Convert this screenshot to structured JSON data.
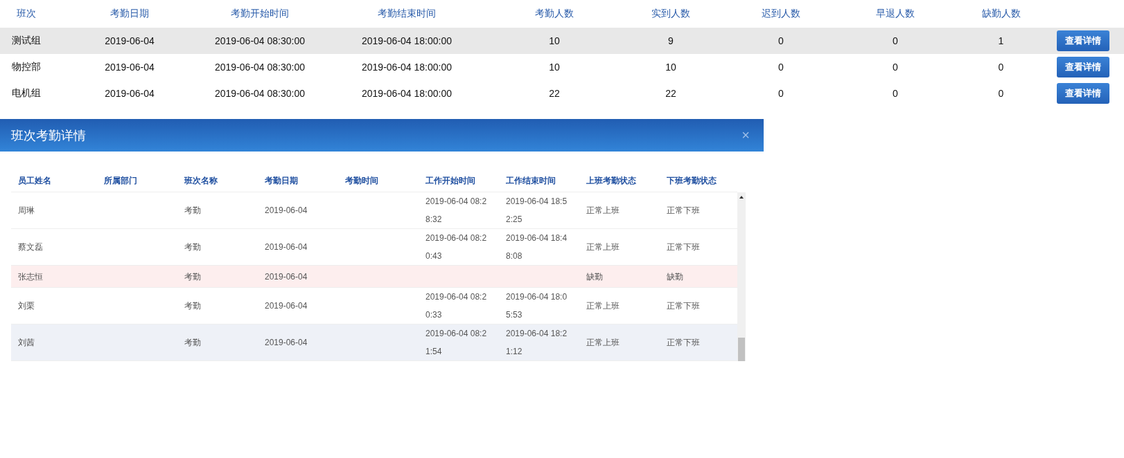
{
  "summary_table": {
    "columns": [
      "班次",
      "考勤日期",
      "考勤开始时间",
      "考勤结束时间",
      "考勤人数",
      "实到人数",
      "迟到人数",
      "早退人数",
      "缺勤人数"
    ],
    "rows": [
      {
        "selected": true,
        "cells": [
          "测试组",
          "2019-06-04",
          "2019-06-04 08:30:00",
          "2019-06-04 18:00:00",
          "10",
          "9",
          "0",
          "0",
          "1"
        ],
        "button": "查看详情"
      },
      {
        "selected": false,
        "cells": [
          "物控部",
          "2019-06-04",
          "2019-06-04 08:30:00",
          "2019-06-04 18:00:00",
          "10",
          "10",
          "0",
          "0",
          "0"
        ],
        "button": "查看详情"
      },
      {
        "selected": false,
        "cells": [
          "电机组",
          "2019-06-04",
          "2019-06-04 08:30:00",
          "2019-06-04 18:00:00",
          "22",
          "22",
          "0",
          "0",
          "0"
        ],
        "button": "查看详情"
      }
    ]
  },
  "dialog": {
    "title": "班次考勤详情",
    "close": "×",
    "columns": [
      "员工姓名",
      "所属部门",
      "班次名称",
      "考勤日期",
      "考勤时间",
      "工作开始时间",
      "工作结束时间",
      "上班考勤状态",
      "下班考勤状态"
    ],
    "rows": [
      {
        "absent": false,
        "highlighted": false,
        "cells": [
          "周琳",
          "",
          "考勤",
          "2019-06-04",
          "",
          "2019-06-04 08:28:32",
          "2019-06-04 18:52:25",
          "正常上班",
          "正常下班"
        ]
      },
      {
        "absent": false,
        "highlighted": false,
        "cells": [
          "蔡文磊",
          "",
          "考勤",
          "2019-06-04",
          "",
          "2019-06-04 08:20:43",
          "2019-06-04 18:48:08",
          "正常上班",
          "正常下班"
        ]
      },
      {
        "absent": true,
        "highlighted": false,
        "cells": [
          "张志恒",
          "",
          "考勤",
          "2019-06-04",
          "",
          "",
          "",
          "缺勤",
          "缺勤"
        ]
      },
      {
        "absent": false,
        "highlighted": false,
        "cells": [
          "刘栗",
          "",
          "考勤",
          "2019-06-04",
          "",
          "2019-06-04 08:20:33",
          "2019-06-04 18:05:53",
          "正常上班",
          "正常下班"
        ]
      },
      {
        "absent": false,
        "highlighted": true,
        "cells": [
          "刘茜",
          "",
          "考勤",
          "2019-06-04",
          "",
          "2019-06-04 08:21:54",
          "2019-06-04 18:21:12",
          "正常上班",
          "正常下班"
        ]
      }
    ]
  }
}
